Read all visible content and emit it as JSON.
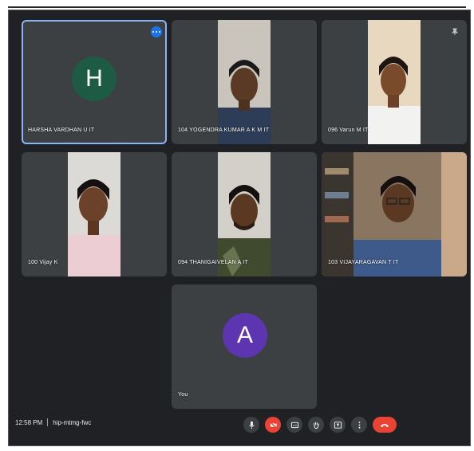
{
  "meeting": {
    "time": "12:58 PM",
    "code": "hip-mtmg-fwc"
  },
  "participants": [
    {
      "name": "HARSHA VARDHAN U IT",
      "initial": "H",
      "avatar_color": "#1e5b45",
      "active_speaker": true
    },
    {
      "name": "104 YOGENDRA KUMAR A K M IT"
    },
    {
      "name": "096 Varun M IT"
    },
    {
      "name": "100 Vijay K"
    },
    {
      "name": "094 THANIGAIVELAN A IT"
    },
    {
      "name": "103 VIJAYARAGAVAN T IT"
    },
    {
      "name": "You",
      "initial": "A",
      "avatar_color": "#5e35b1"
    }
  ],
  "controls": [
    {
      "name": "mic-icon"
    },
    {
      "name": "camera-off-icon",
      "color": "#ea4335"
    },
    {
      "name": "captions-icon"
    },
    {
      "name": "raise-hand-icon"
    },
    {
      "name": "present-icon"
    },
    {
      "name": "more-options-icon"
    },
    {
      "name": "end-call-icon",
      "color": "#ea4335"
    }
  ],
  "colors": {
    "background": "#202124",
    "tile": "#3c4043",
    "active_border": "#8ab4f8",
    "danger": "#ea4335"
  }
}
